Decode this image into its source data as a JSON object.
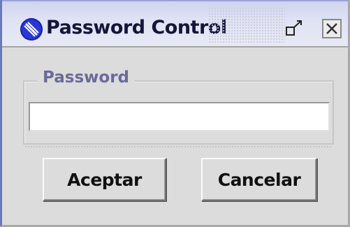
{
  "window": {
    "title": "Password Control",
    "app_icon": "no-entry-icon",
    "controls": {
      "restore_icon": "restore-icon",
      "close_icon": "close-icon"
    }
  },
  "password_group": {
    "legend": "Password",
    "input_value": "",
    "input_placeholder": ""
  },
  "buttons": {
    "accept_label": "Aceptar",
    "cancel_label": "Cancelar"
  },
  "colors": {
    "titlebar": "#dfe2f4",
    "title_text": "#13163a",
    "app_icon": "#2a36d8",
    "window_bg": "#dcdcdc",
    "legend_text": "#6a6a9c"
  }
}
